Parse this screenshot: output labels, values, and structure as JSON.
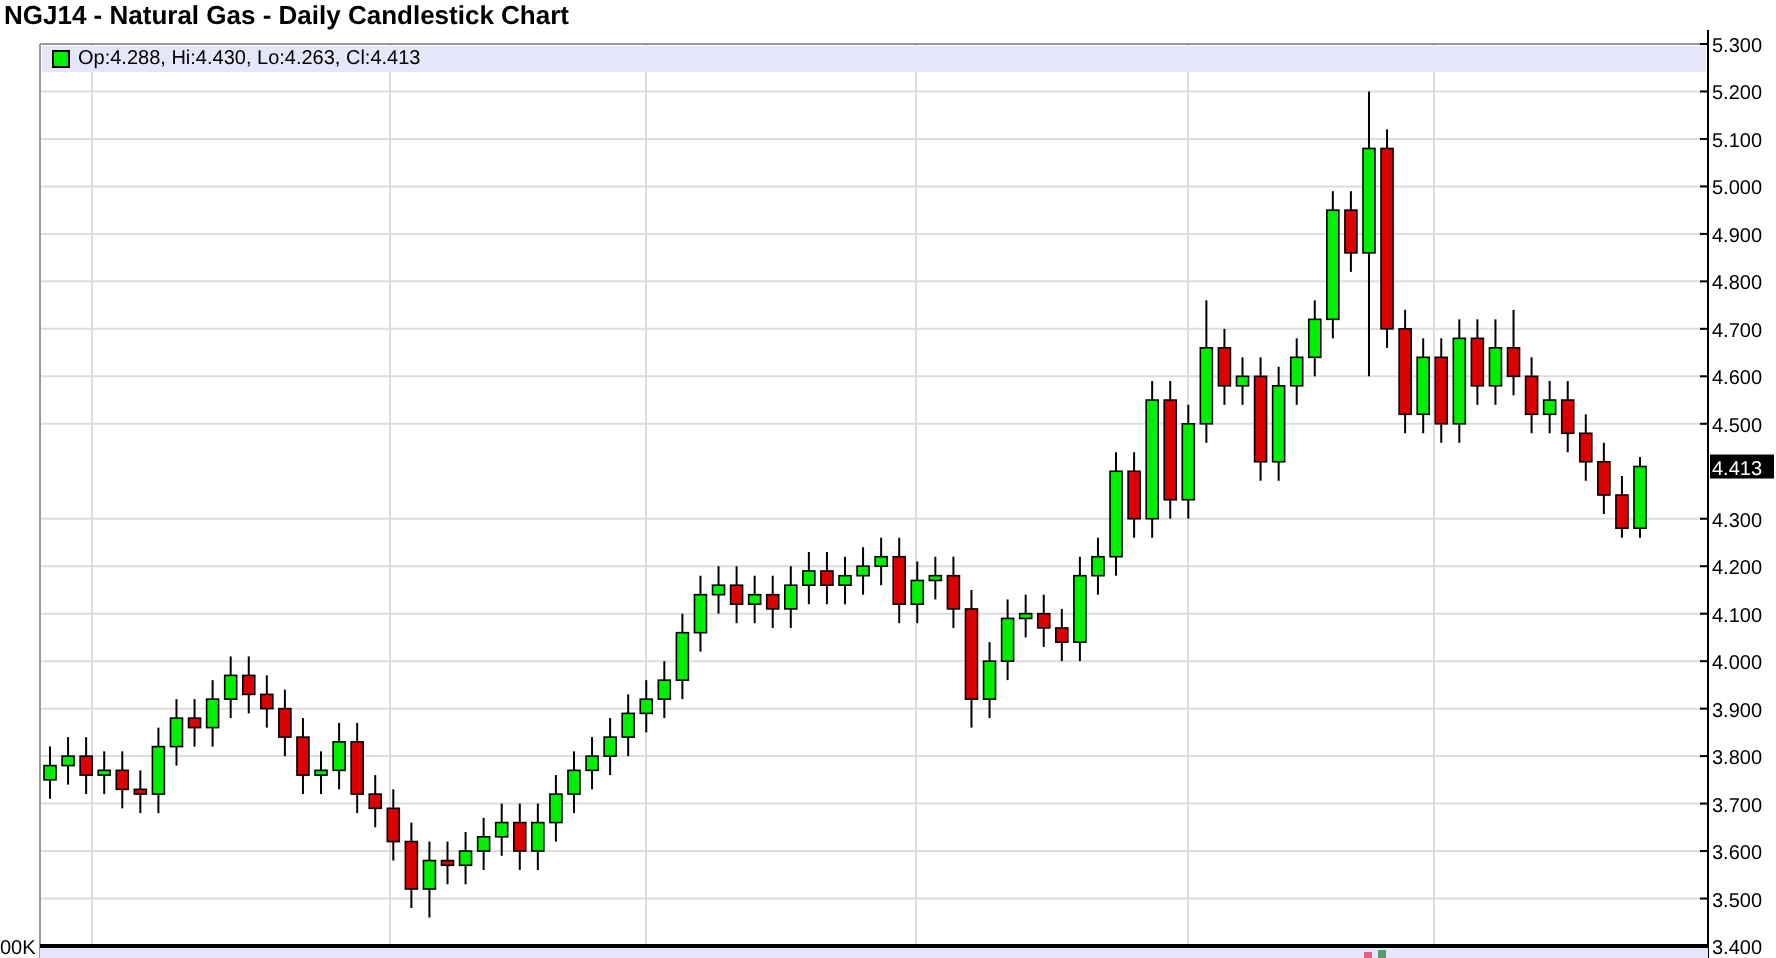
{
  "title": "NGJ14 - Natural Gas - Daily Candlestick Chart",
  "chart": {
    "legend": "Op:4.288, Hi:4.430, Lo:4.263, Cl:4.413",
    "last_price_label": "4.413",
    "volume_axis_label": "00K",
    "chart_data": {
      "type": "candlestick",
      "grid": true,
      "ylim": [
        3.4,
        5.3
      ],
      "yticks": [
        {
          "value": 5.3,
          "label": "5.300"
        },
        {
          "value": 5.2,
          "label": "5.200"
        },
        {
          "value": 5.1,
          "label": "5.100"
        },
        {
          "value": 5.0,
          "label": "5.000"
        },
        {
          "value": 4.9,
          "label": "4.900"
        },
        {
          "value": 4.8,
          "label": "4.800"
        },
        {
          "value": 4.7,
          "label": "4.700"
        },
        {
          "value": 4.6,
          "label": "4.600"
        },
        {
          "value": 4.5,
          "label": "4.500"
        },
        {
          "value": 4.3,
          "label": "4.300"
        },
        {
          "value": 4.2,
          "label": "4.200"
        },
        {
          "value": 4.1,
          "label": "4.100"
        },
        {
          "value": 4.0,
          "label": "4.000"
        },
        {
          "value": 3.9,
          "label": "3.900"
        },
        {
          "value": 3.8,
          "label": "3.800"
        },
        {
          "value": 3.7,
          "label": "3.700"
        },
        {
          "value": 3.6,
          "label": "3.600"
        },
        {
          "value": 3.5,
          "label": "3.500"
        },
        {
          "value": 3.4,
          "label": "3.400"
        }
      ],
      "ohlc": [
        [
          3.75,
          3.82,
          3.71,
          3.78
        ],
        [
          3.78,
          3.84,
          3.74,
          3.8
        ],
        [
          3.8,
          3.84,
          3.72,
          3.76
        ],
        [
          3.76,
          3.81,
          3.72,
          3.77
        ],
        [
          3.77,
          3.81,
          3.69,
          3.73
        ],
        [
          3.73,
          3.77,
          3.68,
          3.72
        ],
        [
          3.72,
          3.86,
          3.68,
          3.82
        ],
        [
          3.82,
          3.92,
          3.78,
          3.88
        ],
        [
          3.88,
          3.92,
          3.82,
          3.86
        ],
        [
          3.86,
          3.96,
          3.82,
          3.92
        ],
        [
          3.92,
          4.01,
          3.88,
          3.97
        ],
        [
          3.97,
          4.01,
          3.89,
          3.93
        ],
        [
          3.93,
          3.97,
          3.86,
          3.9
        ],
        [
          3.9,
          3.94,
          3.8,
          3.84
        ],
        [
          3.84,
          3.88,
          3.72,
          3.76
        ],
        [
          3.76,
          3.81,
          3.72,
          3.77
        ],
        [
          3.77,
          3.87,
          3.73,
          3.83
        ],
        [
          3.83,
          3.87,
          3.68,
          3.72
        ],
        [
          3.72,
          3.76,
          3.65,
          3.69
        ],
        [
          3.69,
          3.73,
          3.58,
          3.62
        ],
        [
          3.62,
          3.66,
          3.48,
          3.52
        ],
        [
          3.52,
          3.62,
          3.46,
          3.58
        ],
        [
          3.58,
          3.62,
          3.53,
          3.57
        ],
        [
          3.57,
          3.64,
          3.53,
          3.6
        ],
        [
          3.6,
          3.67,
          3.56,
          3.63
        ],
        [
          3.63,
          3.7,
          3.59,
          3.66
        ],
        [
          3.66,
          3.7,
          3.56,
          3.6
        ],
        [
          3.6,
          3.7,
          3.56,
          3.66
        ],
        [
          3.66,
          3.76,
          3.62,
          3.72
        ],
        [
          3.72,
          3.81,
          3.68,
          3.77
        ],
        [
          3.77,
          3.84,
          3.73,
          3.8
        ],
        [
          3.8,
          3.88,
          3.76,
          3.84
        ],
        [
          3.84,
          3.93,
          3.8,
          3.89
        ],
        [
          3.89,
          3.96,
          3.85,
          3.92
        ],
        [
          3.92,
          4.0,
          3.88,
          3.96
        ],
        [
          3.96,
          4.1,
          3.92,
          4.06
        ],
        [
          4.06,
          4.18,
          4.02,
          4.14
        ],
        [
          4.14,
          4.2,
          4.1,
          4.16
        ],
        [
          4.16,
          4.2,
          4.08,
          4.12
        ],
        [
          4.12,
          4.18,
          4.08,
          4.14
        ],
        [
          4.14,
          4.18,
          4.07,
          4.11
        ],
        [
          4.11,
          4.2,
          4.07,
          4.16
        ],
        [
          4.16,
          4.23,
          4.12,
          4.19
        ],
        [
          4.19,
          4.23,
          4.12,
          4.16
        ],
        [
          4.16,
          4.22,
          4.12,
          4.18
        ],
        [
          4.18,
          4.24,
          4.14,
          4.2
        ],
        [
          4.2,
          4.26,
          4.16,
          4.22
        ],
        [
          4.22,
          4.26,
          4.08,
          4.12
        ],
        [
          4.12,
          4.21,
          4.08,
          4.17
        ],
        [
          4.17,
          4.22,
          4.13,
          4.18
        ],
        [
          4.18,
          4.22,
          4.07,
          4.11
        ],
        [
          4.11,
          4.15,
          3.86,
          3.92
        ],
        [
          3.92,
          4.04,
          3.88,
          4.0
        ],
        [
          4.0,
          4.13,
          3.96,
          4.09
        ],
        [
          4.09,
          4.14,
          4.05,
          4.1
        ],
        [
          4.1,
          4.14,
          4.03,
          4.07
        ],
        [
          4.07,
          4.11,
          4.0,
          4.04
        ],
        [
          4.04,
          4.22,
          4.0,
          4.18
        ],
        [
          4.18,
          4.26,
          4.14,
          4.22
        ],
        [
          4.22,
          4.44,
          4.18,
          4.4
        ],
        [
          4.4,
          4.44,
          4.26,
          4.3
        ],
        [
          4.3,
          4.59,
          4.26,
          4.55
        ],
        [
          4.55,
          4.59,
          4.3,
          4.34
        ],
        [
          4.34,
          4.54,
          4.3,
          4.5
        ],
        [
          4.5,
          4.76,
          4.46,
          4.66
        ],
        [
          4.66,
          4.7,
          4.54,
          4.58
        ],
        [
          4.58,
          4.64,
          4.54,
          4.6
        ],
        [
          4.6,
          4.64,
          4.38,
          4.42
        ],
        [
          4.42,
          4.62,
          4.38,
          4.58
        ],
        [
          4.58,
          4.68,
          4.54,
          4.64
        ],
        [
          4.64,
          4.76,
          4.6,
          4.72
        ],
        [
          4.72,
          4.99,
          4.68,
          4.95
        ],
        [
          4.95,
          4.99,
          4.82,
          4.86
        ],
        [
          4.86,
          5.2,
          4.6,
          5.08
        ],
        [
          5.08,
          5.12,
          4.66,
          4.7
        ],
        [
          4.7,
          4.74,
          4.48,
          4.52
        ],
        [
          4.52,
          4.68,
          4.48,
          4.64
        ],
        [
          4.64,
          4.68,
          4.46,
          4.5
        ],
        [
          4.5,
          4.72,
          4.46,
          4.68
        ],
        [
          4.68,
          4.72,
          4.54,
          4.58
        ],
        [
          4.58,
          4.72,
          4.54,
          4.66
        ],
        [
          4.66,
          4.74,
          4.56,
          4.6
        ],
        [
          4.6,
          4.64,
          4.48,
          4.52
        ],
        [
          4.52,
          4.59,
          4.48,
          4.55
        ],
        [
          4.55,
          4.59,
          4.44,
          4.48
        ],
        [
          4.48,
          4.52,
          4.38,
          4.42
        ],
        [
          4.42,
          4.46,
          4.31,
          4.35
        ],
        [
          4.35,
          4.39,
          4.26,
          4.28
        ],
        [
          4.28,
          4.43,
          4.26,
          4.41
        ]
      ]
    }
  }
}
